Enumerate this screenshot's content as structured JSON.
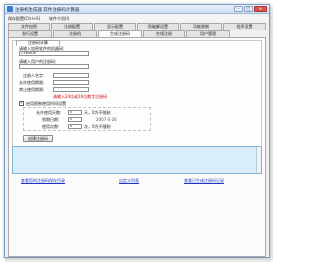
{
  "window": {
    "title": "注册机生成器 软件注册码计算器",
    "min_glyph": "–",
    "max_glyph": "□",
    "close_glyph": "✕"
  },
  "menu": [
    "保存配置(Ctrl+S)",
    "软件介绍(I)"
  ],
  "tabs_row1": [
    "文件加密",
    "注册配置",
    "显示配置",
    "防破解设置",
    "功能限制",
    "程序设置"
  ],
  "tabs_row2": [
    "发行设置",
    "注册机",
    "生成注册码",
    "在线注册",
    "用户管理"
  ],
  "form": {
    "subtab": "注册码计算",
    "machine_code_label": "请输入加密软件的机器码:",
    "machine_code_value": "CYW8DK",
    "username_label": "请输入用户的注册码:",
    "owner_label": "注册人名字:",
    "allow_label": "允许使用期限:",
    "forbid_label": "禁止使用期限:",
    "note": "请输入24位或16位数字注册码",
    "set_trial_label": "启用限制使用时间设置",
    "allow_days_label": "允许使用天数:",
    "allow_days_value": "0",
    "allow_days_hint": "天，0为不限制",
    "expire_label": "到期日期:",
    "expire_value": "0",
    "expire_date": "2007-0-26",
    "count_label": "使用次数:",
    "count_value": "0",
    "count_hint": "次，0为不限制",
    "generate_button": "创建注册码"
  },
  "links": [
    "查看您的注册码保存目录",
    "自定义列表",
    "查看已生成注册码记录"
  ]
}
